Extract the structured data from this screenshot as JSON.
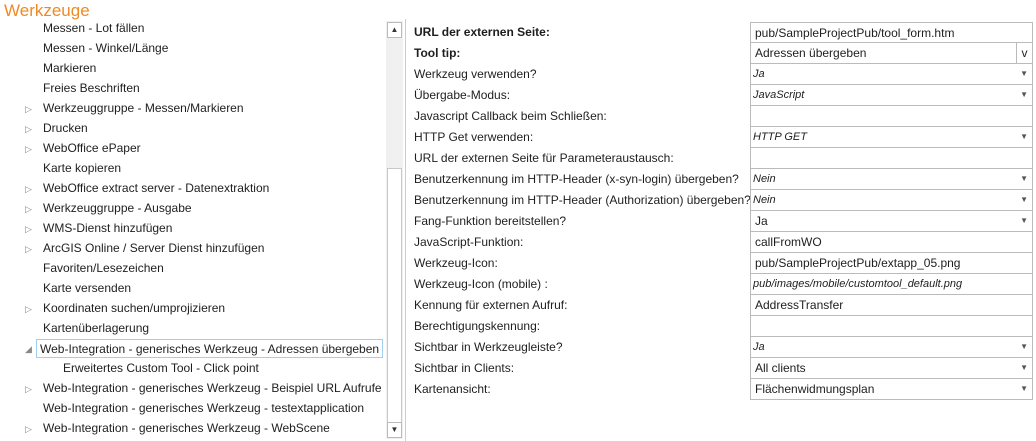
{
  "title": "Werkzeuge",
  "tree": [
    {
      "label": "Messen - Lot fällen",
      "expander": false
    },
    {
      "label": "Messen - Winkel/Länge",
      "expander": false
    },
    {
      "label": "Markieren",
      "expander": false
    },
    {
      "label": "Freies Beschriften",
      "expander": false
    },
    {
      "label": "Werkzeuggruppe - Messen/Markieren",
      "expander": true
    },
    {
      "label": "Drucken",
      "expander": true
    },
    {
      "label": "WebOffice ePaper",
      "expander": true
    },
    {
      "label": "Karte kopieren",
      "expander": false
    },
    {
      "label": "WebOffice extract server - Datenextraktion",
      "expander": true
    },
    {
      "label": "Werkzeuggruppe - Ausgabe",
      "expander": true
    },
    {
      "label": "WMS-Dienst hinzufügen",
      "expander": true
    },
    {
      "label": "ArcGIS Online / Server Dienst hinzufügen",
      "expander": true
    },
    {
      "label": "Favoriten/Lesezeichen",
      "expander": false
    },
    {
      "label": "Karte versenden",
      "expander": false
    },
    {
      "label": "Koordinaten suchen/umprojizieren",
      "expander": true
    },
    {
      "label": "Kartenüberlagerung",
      "expander": false
    },
    {
      "label": "Web-Integration - generisches Werkzeug - Adressen übergeben",
      "expander": "open",
      "selected": true
    },
    {
      "label": "Erweitertes Custom Tool - Click point",
      "expander": false,
      "child": true
    },
    {
      "label": "Web-Integration - generisches Werkzeug - Beispiel URL Aufrufe",
      "expander": true
    },
    {
      "label": "Web-Integration - generisches Werkzeug - testextapplication",
      "expander": false
    },
    {
      "label": "Web-Integration - generisches Werkzeug - WebScene",
      "expander": true
    }
  ],
  "properties": [
    {
      "label": "URL der externen Seite:",
      "value": "pub/SampleProjectPub/tool_form.htm",
      "bold": true,
      "type": "text"
    },
    {
      "label": "Tool tip:",
      "value": "Adressen übergeben",
      "bold": true,
      "type": "button",
      "button": "v"
    },
    {
      "label": "Werkzeug verwenden?",
      "value": "Ja",
      "type": "select",
      "italic": true
    },
    {
      "label": "Übergabe-Modus:",
      "value": "JavaScript",
      "type": "select",
      "italic": true
    },
    {
      "label": "Javascript Callback beim Schließen:",
      "value": "",
      "type": "text"
    },
    {
      "label": "HTTP Get verwenden:",
      "value": "HTTP GET",
      "type": "select",
      "italic": true
    },
    {
      "label": "URL der externen Seite für Parameteraustausch:",
      "value": "",
      "type": "text"
    },
    {
      "label": "Benutzerkennung im HTTP-Header (x-syn-login) übergeben?",
      "value": "Nein",
      "type": "select",
      "italic": true
    },
    {
      "label": "Benutzerkennung im HTTP-Header (Authorization) übergeben?",
      "value": "Nein",
      "type": "select",
      "italic": true
    },
    {
      "label": "Fang-Funktion bereitstellen?",
      "value": "Ja",
      "type": "select"
    },
    {
      "label": "JavaScript-Funktion:",
      "value": "callFromWO",
      "type": "text"
    },
    {
      "label": "Werkzeug-Icon:",
      "value": "pub/SampleProjectPub/extapp_05.png",
      "type": "text"
    },
    {
      "label": "Werkzeug-Icon (mobile) :",
      "value": "pub/images/mobile/customtool_default.png",
      "type": "text",
      "italic": true
    },
    {
      "label": "Kennung für externen Aufruf:",
      "value": "AddressTransfer",
      "type": "text"
    },
    {
      "label": "Berechtigungskennung:",
      "value": "",
      "type": "text"
    },
    {
      "label": "Sichtbar in Werkzeugleiste?",
      "value": "Ja",
      "type": "select",
      "italic": true
    },
    {
      "label": "Sichtbar in Clients:",
      "value": "All clients",
      "type": "select"
    },
    {
      "label": "Kartenansicht:",
      "value": "Flächenwidmungsplan",
      "type": "select"
    }
  ]
}
